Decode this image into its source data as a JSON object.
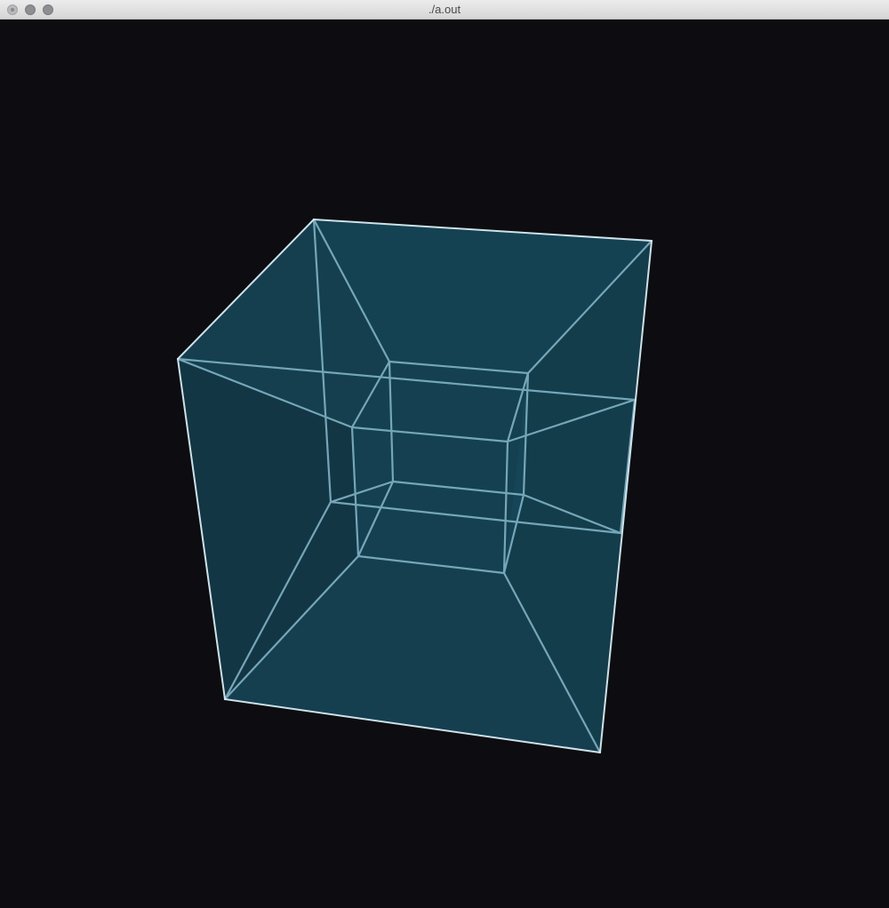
{
  "window": {
    "title": "./a.out"
  },
  "colors": {
    "background": "#0d0c10",
    "face_fill": "#1a5a70",
    "edge_inner": "#7fb3c4",
    "edge_outer": "#d8ecf2"
  },
  "icons": {
    "close": "close-button",
    "minimize": "minimize-button",
    "zoom": "zoom-button"
  }
}
